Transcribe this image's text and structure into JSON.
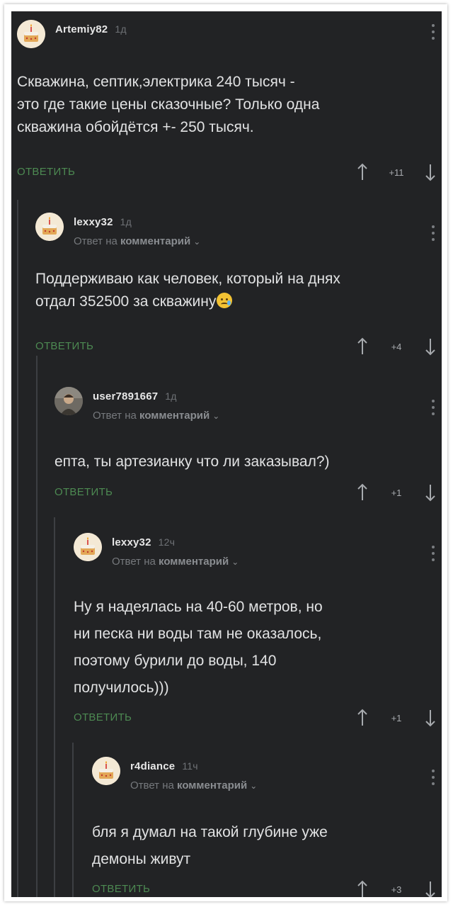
{
  "comments": [
    {
      "username": "Artemiy82",
      "time": "1д",
      "reply_to": null,
      "text": "Скважина, септик,электрика 240 тысяч -\nэто где такие цены сказочные? Только одна\nскважина обойдётся +- 250 тысяч.",
      "reply_label": "ОТВЕТИТЬ",
      "score": "+11",
      "avatar": "default-avatar"
    },
    {
      "username": "lexxy32",
      "time": "1д",
      "reply_to": {
        "prefix": "Ответ на",
        "target": "комментарий"
      },
      "text": "Поддерживаю как человек, который на днях\nотдал 352500 за скважину",
      "emoji": "smiling-face-with-tear",
      "reply_label": "ОТВЕТИТЬ",
      "score": "+4",
      "avatar": "default-avatar"
    },
    {
      "username": "user7891667",
      "time": "1д",
      "reply_to": {
        "prefix": "Ответ на",
        "target": "комментарий"
      },
      "text": "епта, ты артезианку что ли заказывал?)",
      "reply_label": "ОТВЕТИТЬ",
      "score": "+1",
      "avatar": "photo-avatar"
    },
    {
      "username": "lexxy32",
      "time": "12ч",
      "reply_to": {
        "prefix": "Ответ на",
        "target": "комментарий"
      },
      "text": "Ну я надеялась на 40-60 метров, но\nни песка ни воды там не оказалось,\nпоэтому бурили до воды, 140\nполучилось)))",
      "reply_label": "ОТВЕТИТЬ",
      "score": "+1",
      "avatar": "default-avatar"
    },
    {
      "username": "r4diance",
      "time": "11ч",
      "reply_to": {
        "prefix": "Ответ на",
        "target": "комментарий"
      },
      "text": "бля я думал на такой глубине уже\nдемоны живут",
      "reply_label": "ОТВЕТИТЬ",
      "score": "+3",
      "avatar": "default-avatar"
    }
  ],
  "icons": {
    "upvote": "arrow-up-icon",
    "downvote": "arrow-down-icon",
    "menu": "more-vertical-icon",
    "chevron": "chevron-down-icon"
  },
  "colors": {
    "background": "#222325",
    "text": "#e1e2e3",
    "reply_button": "#4d8a52",
    "muted": "#76797d"
  }
}
